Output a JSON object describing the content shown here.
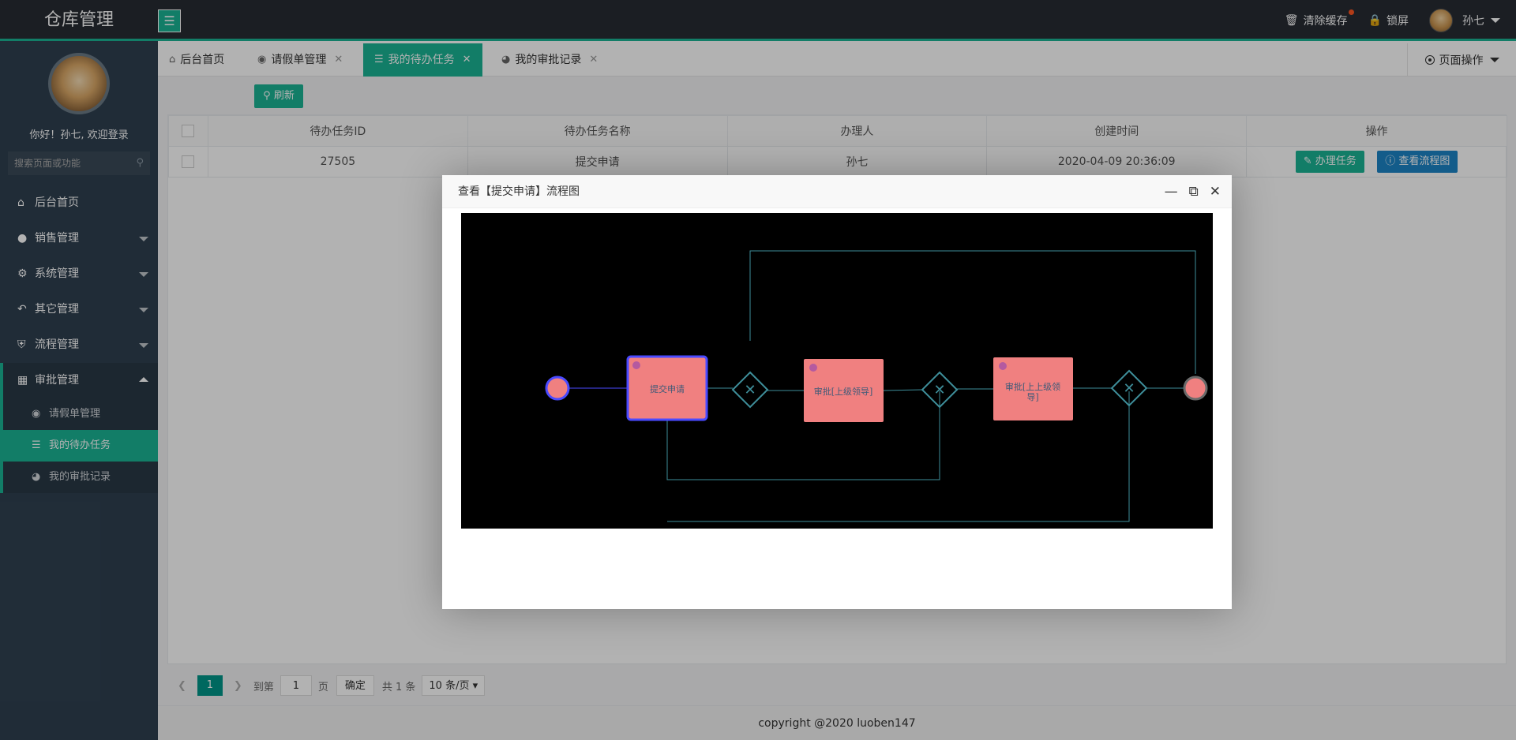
{
  "app": {
    "title": "仓库管理",
    "toggle_icon": "hamburger-icon"
  },
  "topbar": {
    "clear_cache": "清除缓存",
    "lock_screen": "锁屏",
    "user_name": "孙七"
  },
  "sidebar": {
    "welcome": "你好！孙七, 欢迎登录",
    "search_placeholder": "搜索页面或功能",
    "items": [
      {
        "label": "后台首页",
        "icon": "home-icon"
      },
      {
        "label": "销售管理",
        "icon": "chat-icon"
      },
      {
        "label": "系统管理",
        "icon": "gear-icon"
      },
      {
        "label": "其它管理",
        "icon": "logout-icon"
      },
      {
        "label": "流程管理",
        "icon": "shield-icon"
      },
      {
        "label": "审批管理",
        "icon": "apps-icon"
      }
    ],
    "sub_items": [
      {
        "label": "请假单管理",
        "icon": "palette-icon"
      },
      {
        "label": "我的待办任务",
        "icon": "list-icon"
      },
      {
        "label": "我的审批记录",
        "icon": "dashboard-icon"
      }
    ]
  },
  "tabs": [
    {
      "label": "后台首页"
    },
    {
      "label": "请假单管理"
    },
    {
      "label": "我的待办任务"
    },
    {
      "label": "我的审批记录"
    }
  ],
  "page_ops": "页面操作",
  "toolbar": {
    "refresh": "刷新"
  },
  "table": {
    "headers": [
      "待办任务ID",
      "待办任务名称",
      "办理人",
      "创建时间",
      "操作"
    ],
    "rows": [
      {
        "id": "27505",
        "name": "提交申请",
        "handler": "孙七",
        "created": "2020-04-09 20:36:09"
      }
    ],
    "btn_handle": "办理任务",
    "btn_view": "查看流程图"
  },
  "pager": {
    "current": "1",
    "goto_label": "到第",
    "goto_value": "1",
    "page_unit": "页",
    "confirm": "确定",
    "total": "共 1 条",
    "page_size": "10 条/页"
  },
  "footer": "copyright @2020 luoben147",
  "modal": {
    "title": "查看【提交申请】流程图",
    "diagram": {
      "task1": "提交申请",
      "task2": "审批[上级领导]",
      "task3_line1": "审批[上上级领",
      "task3_line2": "导]"
    }
  }
}
